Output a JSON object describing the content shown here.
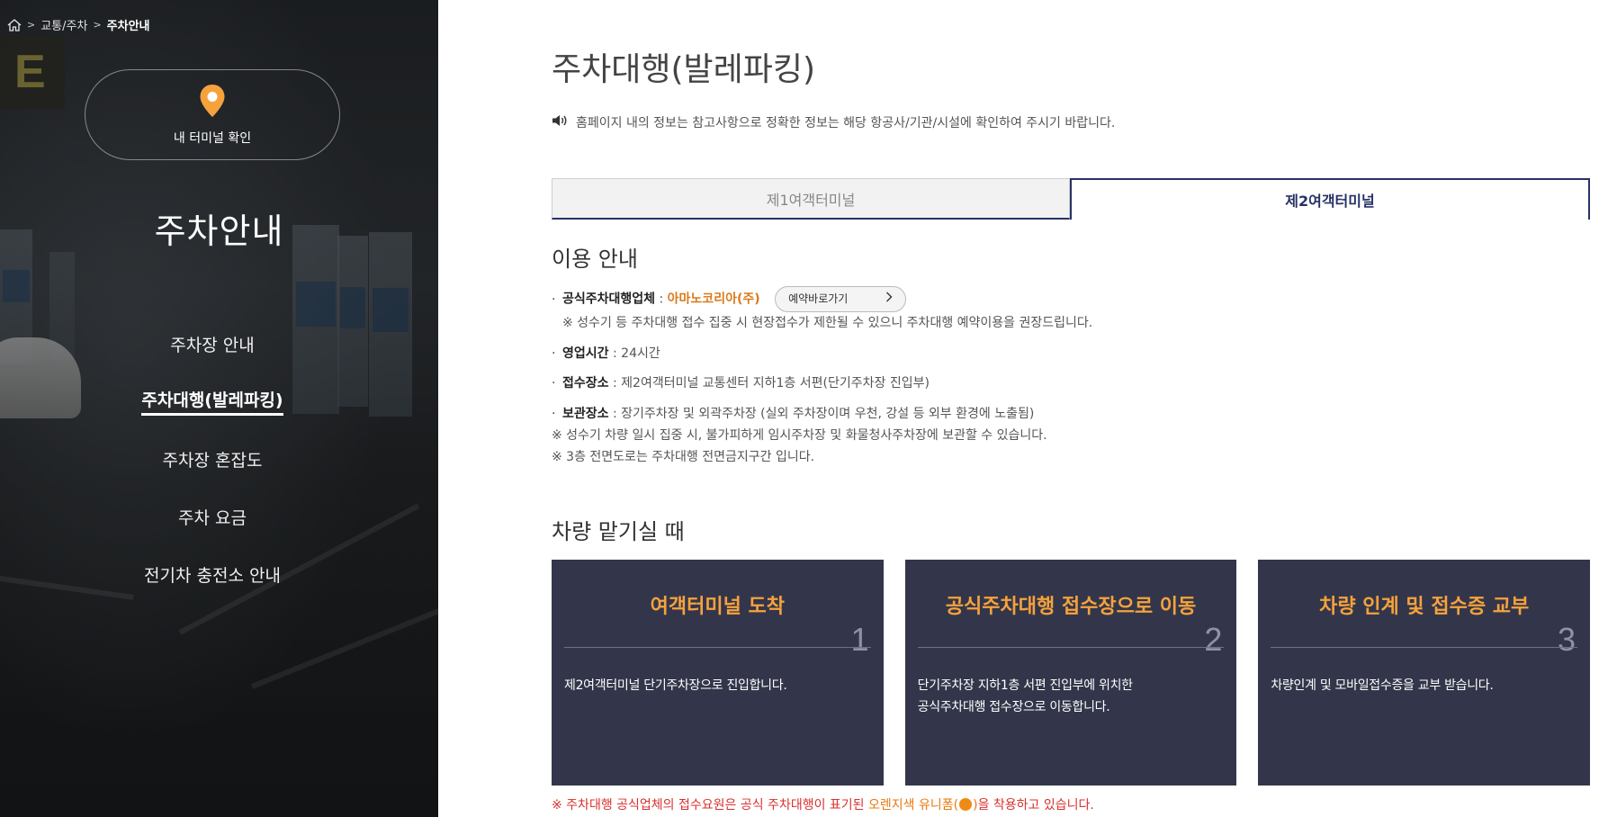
{
  "breadcrumb": {
    "items": [
      "교통/주차",
      "주차안내"
    ],
    "sep": ">"
  },
  "sidebar": {
    "terminal_check_label": "내 터미널 확인",
    "title": "주차안내",
    "menu": [
      {
        "label": "주차장 안내",
        "active": false
      },
      {
        "label": "주차대행(발레파킹)",
        "active": true
      },
      {
        "label": "주차장 혼잡도",
        "active": false
      },
      {
        "label": "주차 요금",
        "active": false
      },
      {
        "label": "전기차 충전소 안내",
        "active": false
      }
    ]
  },
  "main": {
    "title": "주차대행(발레파킹)",
    "notice": "홈페이지 내의 정보는 참고사항으로 정확한 정보는 해당 항공사/기관/시설에 확인하여 주시기 바랍니다.",
    "tabs": [
      {
        "label": "제1여객터미널",
        "active": false
      },
      {
        "label": "제2여객터미널",
        "active": true
      }
    ],
    "usage": {
      "title": "이용 안내",
      "vendor_label": "공식주차대행업체",
      "vendor_name": "아마노코리아(주)",
      "reserve_button": "예약바로가기",
      "vendor_note": "※ 성수기 등 주차대행 접수 집중 시 현장접수가 제한될 수 있으니 주차대행 예약이용을 권장드립니다.",
      "hours_label": "영업시간",
      "hours_value": "24시간",
      "reception_label": "접수장소",
      "reception_value": "제2여객터미널 교통센터 지하1층 서편(단기주차장 진입부)",
      "storage_label": "보관장소",
      "storage_value": "장기주차장 및 외곽주차장 (실외 주차장이며 우천, 강설 등 외부 환경에 노출됨)",
      "storage_note1": "※ 성수기 차량 일시 집중 시, 불가피하게 임시주차장 및 화물청사주차장에 보관할 수 있습니다.",
      "storage_note2": "※ 3층 전면도로는 주차대행 전면금지구간 입니다."
    },
    "dropoff": {
      "title": "차량 맡기실 때",
      "steps": [
        {
          "title": "여객터미널 도착",
          "num": "1",
          "desc": "제2여객터미널 단기주차장으로 진입합니다."
        },
        {
          "title": "공식주차대행 접수장으로 이동",
          "num": "2",
          "desc": "단기주차장 지하1층 서편 진입부에 위치한\n공식주차대행 접수장으로 이동합니다."
        },
        {
          "title": "차량 인계 및 접수증 교부",
          "num": "3",
          "desc": "차량인계 및 모바일접수증을 교부 받습니다."
        }
      ]
    },
    "footer_note": {
      "prefix": "※ 주차대행 공식업체의 접수요원은 공식 주차대행이 표기된 ",
      "highlight": "오렌지색 유니폼(",
      "suffix_close": ")",
      "suffix": "을 착용하고 있습니다."
    }
  },
  "colors": {
    "navy": "#273266",
    "card_bg": "#33364a",
    "accent_orange": "#f5a23d",
    "warning_red": "#d9302e"
  }
}
